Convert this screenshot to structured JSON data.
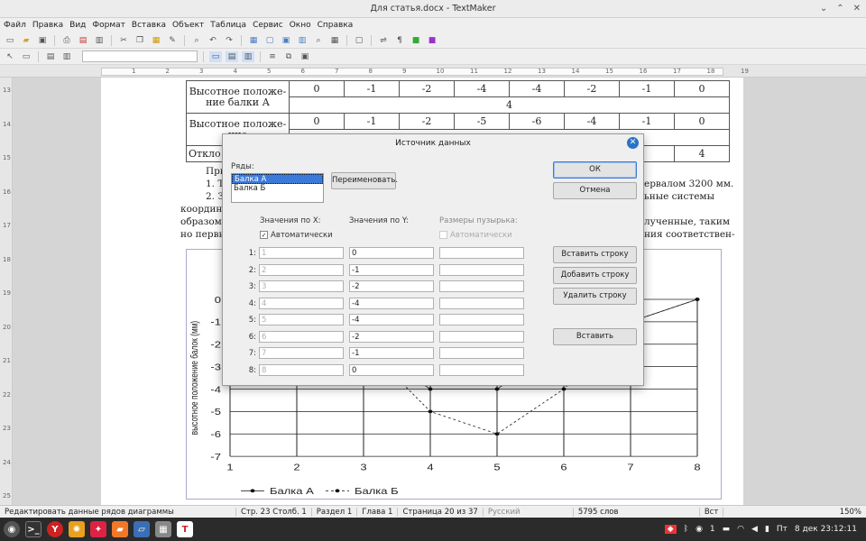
{
  "window": {
    "title": "Для статья.docx - TextMaker"
  },
  "menu": [
    "Файл",
    "Правка",
    "Вид",
    "Формат",
    "Вставка",
    "Объект",
    "Таблица",
    "Сервис",
    "Окно",
    "Справка"
  ],
  "ruler": {
    "ticks": [
      "1",
      "2",
      "3",
      "4",
      "5",
      "6",
      "7",
      "8",
      "9",
      "10",
      "11",
      "12",
      "13",
      "14",
      "15",
      "16",
      "17",
      "18",
      "19"
    ]
  },
  "vruler": [
    "13",
    "14",
    "15",
    "16",
    "17",
    "18",
    "19",
    "20",
    "21",
    "22",
    "23",
    "24",
    "25"
  ],
  "doc": {
    "table": {
      "rows": [
        {
          "label": "Высотное положе-ние балки А",
          "cells": [
            "0",
            "-1",
            "-2",
            "-4",
            "-4",
            "-2",
            "-1",
            "0"
          ],
          "merged": "4"
        },
        {
          "label": "Высотное положе-ние",
          "cells": [
            "0",
            "-1",
            "-2",
            "-5",
            "-6",
            "-4",
            "-1",
            "0"
          ]
        },
        {
          "label": "Откло",
          "last": "4"
        }
      ]
    },
    "text_lines": [
      "При",
      "1. Т",
      "2. З",
      "координа",
      "образом,",
      "но первы"
    ],
    "text_right": [
      "ервалом 3200 мм.",
      "ьные системы",
      "лученные, таким",
      "ния соответствен-"
    ]
  },
  "chart_data": {
    "type": "line",
    "ylabel": "высотное положение балок (мм)",
    "x": [
      1,
      2,
      3,
      4,
      5,
      6,
      7,
      8
    ],
    "xlim": [
      1,
      8
    ],
    "ylim": [
      -7,
      0
    ],
    "yticks": [
      "0",
      "-1",
      "-2",
      "-3",
      "-4",
      "-5",
      "-6",
      "-7"
    ],
    "series": [
      {
        "name": "Балка А",
        "values": [
          0,
          -1,
          -2,
          -4,
          -4,
          -2,
          -1,
          0
        ]
      },
      {
        "name": "Балка Б",
        "values": [
          0,
          -1,
          -2,
          -5,
          -6,
          -4,
          -1,
          0
        ]
      }
    ]
  },
  "dialog": {
    "title": "Источник данных",
    "series_label": "Ряды:",
    "series": [
      "Балка А",
      "Балка Б"
    ],
    "rename_btn": "Переименовать.",
    "col_x": "Значения по X:",
    "col_y": "Значения по Y:",
    "col_bubble": "Размеры пузырька:",
    "auto_x": "Автоматически",
    "auto_bubble": "Автоматически",
    "rows": [
      {
        "n": "1:",
        "x": "1",
        "y": "0"
      },
      {
        "n": "2:",
        "x": "2",
        "y": "-1"
      },
      {
        "n": "3:",
        "x": "3",
        "y": "-2"
      },
      {
        "n": "4:",
        "x": "4",
        "y": "-4"
      },
      {
        "n": "5:",
        "x": "5",
        "y": "-4"
      },
      {
        "n": "6:",
        "x": "6",
        "y": "-2"
      },
      {
        "n": "7:",
        "x": "7",
        "y": "-1"
      },
      {
        "n": "8:",
        "x": "8",
        "y": "0"
      }
    ],
    "ok": "ОК",
    "cancel": "Отмена",
    "insert_row": "Вставить строку",
    "add_row": "Добавить строку",
    "delete_row": "Удалить строку",
    "paste": "Вставить"
  },
  "status": {
    "hint": "Редактировать данные рядов диаграммы",
    "pos": "Стр. 23 Столб. 1",
    "section": "Раздел 1",
    "chapter": "Глава 1",
    "page": "Страница 20 из 37",
    "lang": "Русский",
    "words": "5795 слов",
    "mode": "Вст",
    "zoom": "150%"
  },
  "taskbar": {
    "clock": "8 дек 23:12:11",
    "day": "Пт",
    "kbd": "1"
  }
}
